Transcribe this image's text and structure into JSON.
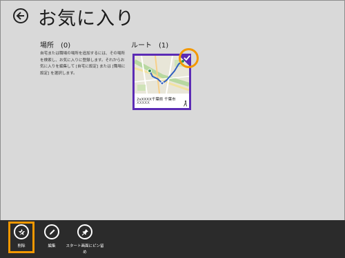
{
  "header": {
    "title": "お気に入り"
  },
  "places": {
    "heading": "場所",
    "count": "(0)",
    "description": "自宅または職場の場所を追加するには、その場所を検索し、お気に入りに登録します。それからお気に入りを編集して [自宅に設定] または [職場に設定] を選択します。"
  },
  "routes": {
    "heading": "ルート",
    "count": "(1)",
    "items": [
      {
        "name": "2xXXXX千葉県 千葉市",
        "sub": "XXXXX",
        "mode_icon": "walk-icon"
      }
    ]
  },
  "app_bar": {
    "buttons": [
      {
        "label": "削除",
        "icon": "star-remove-icon"
      },
      {
        "label": "編集",
        "icon": "pencil-icon"
      },
      {
        "label": "スタート画面にピン留め",
        "icon": "pin-icon"
      }
    ]
  },
  "colors": {
    "accent": "#5b2bb5",
    "highlight": "#f39800",
    "app_bar": "#2b2b2b",
    "background": "#d9d9d9"
  }
}
